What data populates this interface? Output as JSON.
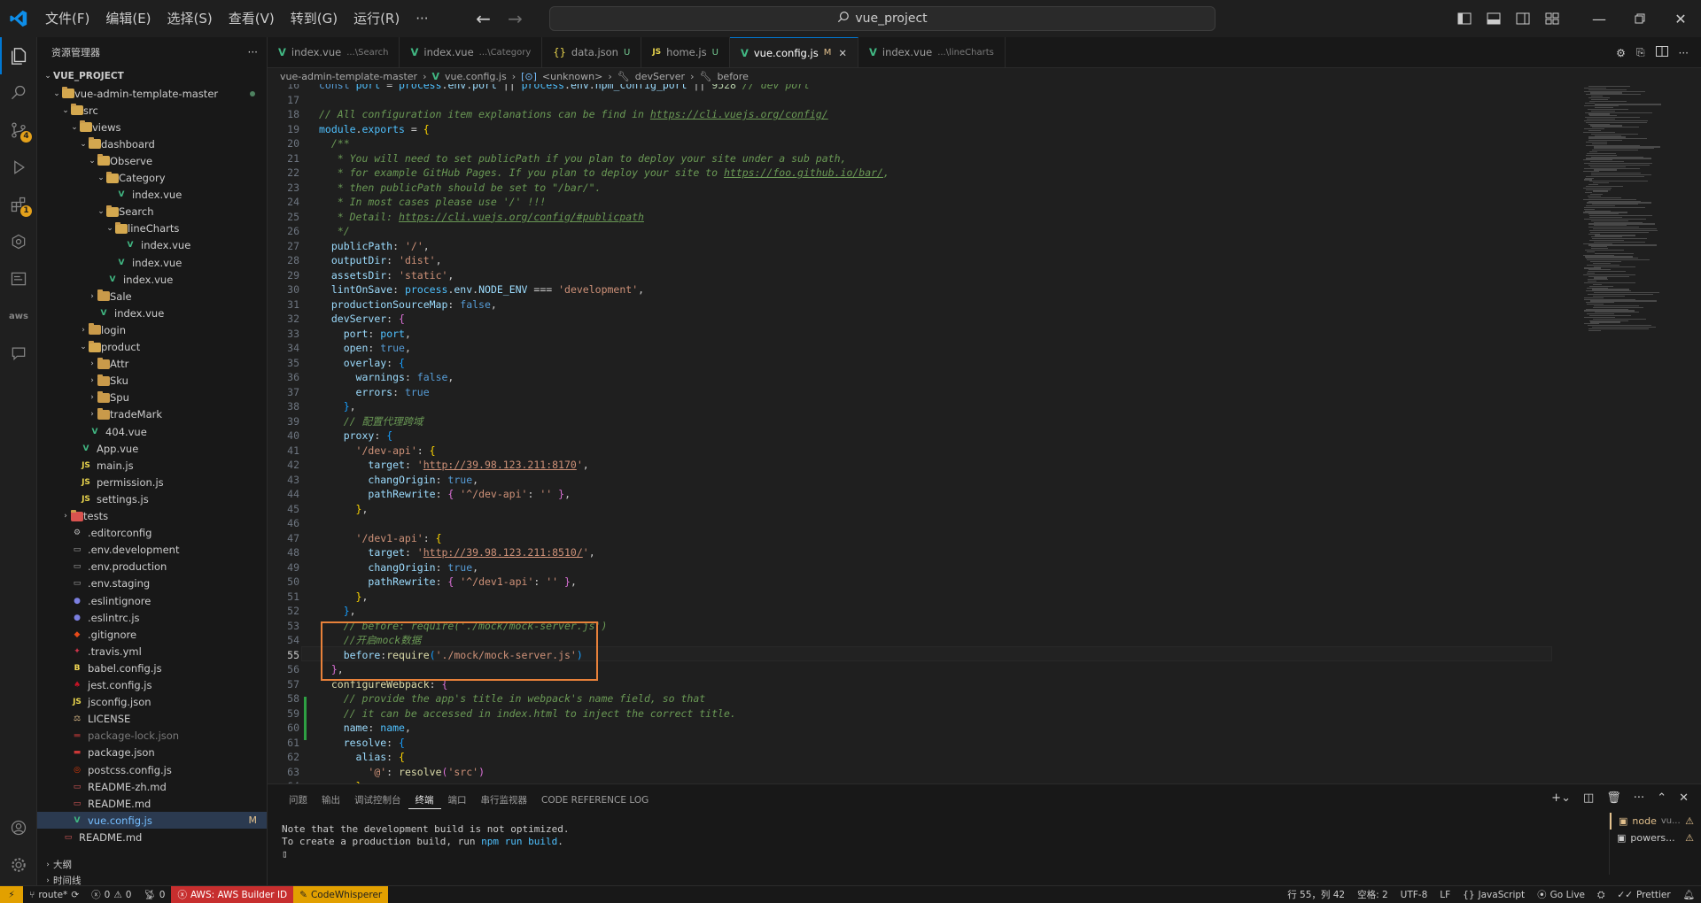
{
  "titlebar": {
    "menus": [
      "文件(F)",
      "编辑(E)",
      "选择(S)",
      "查看(V)",
      "转到(G)",
      "运行(R)",
      "···"
    ],
    "search_text": "vue_project"
  },
  "activity": {
    "source_control_badge": "4",
    "extensions_badge": "1"
  },
  "sidebar": {
    "title": "资源管理器",
    "more": "···",
    "project": "VUE_PROJECT",
    "tree": [
      {
        "label": "vue-admin-template-master",
        "depth": 1,
        "type": "folder-open"
      },
      {
        "label": "src",
        "depth": 2,
        "type": "folder-open"
      },
      {
        "label": "views",
        "depth": 3,
        "type": "folder-open"
      },
      {
        "label": "dashboard",
        "depth": 4,
        "type": "folder-open"
      },
      {
        "label": "Observe",
        "depth": 5,
        "type": "folder-open"
      },
      {
        "label": "Category",
        "depth": 6,
        "type": "folder-open"
      },
      {
        "label": "index.vue",
        "depth": 7,
        "type": "vue"
      },
      {
        "label": "Search",
        "depth": 6,
        "type": "folder-open"
      },
      {
        "label": "lineCharts",
        "depth": 7,
        "type": "folder-open"
      },
      {
        "label": "index.vue",
        "depth": 8,
        "type": "vue"
      },
      {
        "label": "index.vue",
        "depth": 7,
        "type": "vue"
      },
      {
        "label": "index.vue",
        "depth": 6,
        "type": "vue"
      },
      {
        "label": "Sale",
        "depth": 5,
        "type": "folder"
      },
      {
        "label": "index.vue",
        "depth": 5,
        "type": "vue"
      },
      {
        "label": "login",
        "depth": 4,
        "type": "folder"
      },
      {
        "label": "product",
        "depth": 4,
        "type": "folder-open"
      },
      {
        "label": "Attr",
        "depth": 5,
        "type": "folder"
      },
      {
        "label": "Sku",
        "depth": 5,
        "type": "folder"
      },
      {
        "label": "Spu",
        "depth": 5,
        "type": "folder"
      },
      {
        "label": "tradeMark",
        "depth": 5,
        "type": "folder"
      },
      {
        "label": "404.vue",
        "depth": 4,
        "type": "vue"
      },
      {
        "label": "App.vue",
        "depth": 3,
        "type": "vue"
      },
      {
        "label": "main.js",
        "depth": 3,
        "type": "js"
      },
      {
        "label": "permission.js",
        "depth": 3,
        "type": "js"
      },
      {
        "label": "settings.js",
        "depth": 3,
        "type": "js"
      },
      {
        "label": "tests",
        "depth": 2,
        "type": "folder-red"
      },
      {
        "label": ".editorconfig",
        "depth": 2,
        "type": "gear"
      },
      {
        "label": ".env.development",
        "depth": 2,
        "type": "env"
      },
      {
        "label": ".env.production",
        "depth": 2,
        "type": "env"
      },
      {
        "label": ".env.staging",
        "depth": 2,
        "type": "env"
      },
      {
        "label": ".eslintignore",
        "depth": 2,
        "type": "eslint"
      },
      {
        "label": ".eslintrc.js",
        "depth": 2,
        "type": "eslint"
      },
      {
        "label": ".gitignore",
        "depth": 2,
        "type": "git"
      },
      {
        "label": ".travis.yml",
        "depth": 2,
        "type": "travis"
      },
      {
        "label": "babel.config.js",
        "depth": 2,
        "type": "babel"
      },
      {
        "label": "jest.config.js",
        "depth": 2,
        "type": "jest"
      },
      {
        "label": "jsconfig.json",
        "depth": 2,
        "type": "js"
      },
      {
        "label": "LICENSE",
        "depth": 2,
        "type": "license"
      },
      {
        "label": "package-lock.json",
        "depth": 2,
        "type": "npm-dim"
      },
      {
        "label": "package.json",
        "depth": 2,
        "type": "npm"
      },
      {
        "label": "postcss.config.js",
        "depth": 2,
        "type": "postcss"
      },
      {
        "label": "README-zh.md",
        "depth": 2,
        "type": "md"
      },
      {
        "label": "README.md",
        "depth": 2,
        "type": "md"
      },
      {
        "label": "vue.config.js",
        "depth": 2,
        "type": "vue",
        "selected": true,
        "status": "M"
      },
      {
        "label": "README.md",
        "depth": 1,
        "type": "md"
      }
    ],
    "outline": "大纲",
    "timeline": "时间线"
  },
  "tabs": [
    {
      "icon": "vue",
      "label": "index.vue",
      "hint": "...\\Search",
      "status": ""
    },
    {
      "icon": "vue",
      "label": "index.vue",
      "hint": "...\\Category",
      "status": ""
    },
    {
      "icon": "json",
      "label": "data.json",
      "hint": "",
      "status": "U"
    },
    {
      "icon": "js",
      "label": "home.js",
      "hint": "",
      "status": "U"
    },
    {
      "icon": "vue",
      "label": "vue.config.js",
      "hint": "",
      "status": "M",
      "active": true
    },
    {
      "icon": "vue",
      "label": "index.vue",
      "hint": "...\\lineCharts",
      "status": ""
    }
  ],
  "breadcrumb": [
    "vue-admin-template-master",
    "vue.config.js",
    "<unknown>",
    "devServer",
    "before"
  ],
  "editor": {
    "current_line": 55
  },
  "panel": {
    "tabs": [
      "问题",
      "输出",
      "调试控制台",
      "终端",
      "端口",
      "串行监视器",
      "CODE REFERENCE LOG"
    ],
    "active_tab": 3,
    "terminal_lines": [
      "Note that the development build is not optimized.",
      "To create a production build, run ",
      "npm run build",
      "."
    ],
    "terminals": [
      {
        "label": "node",
        "sub": "vu...",
        "active": true
      },
      {
        "label": "powers...",
        "sub": "",
        "active": false
      }
    ]
  },
  "statusbar": {
    "branch": "route*",
    "errors": "0",
    "warnings": "0",
    "ports": "0",
    "aws": "AWS: AWS Builder ID",
    "codewhisperer": "CodeWhisperer",
    "position": "行 55，列 42",
    "spaces": "空格: 2",
    "encoding": "UTF-8",
    "eol": "LF",
    "language": "JavaScript",
    "golive": "Go Live",
    "prettier": "Prettier"
  }
}
